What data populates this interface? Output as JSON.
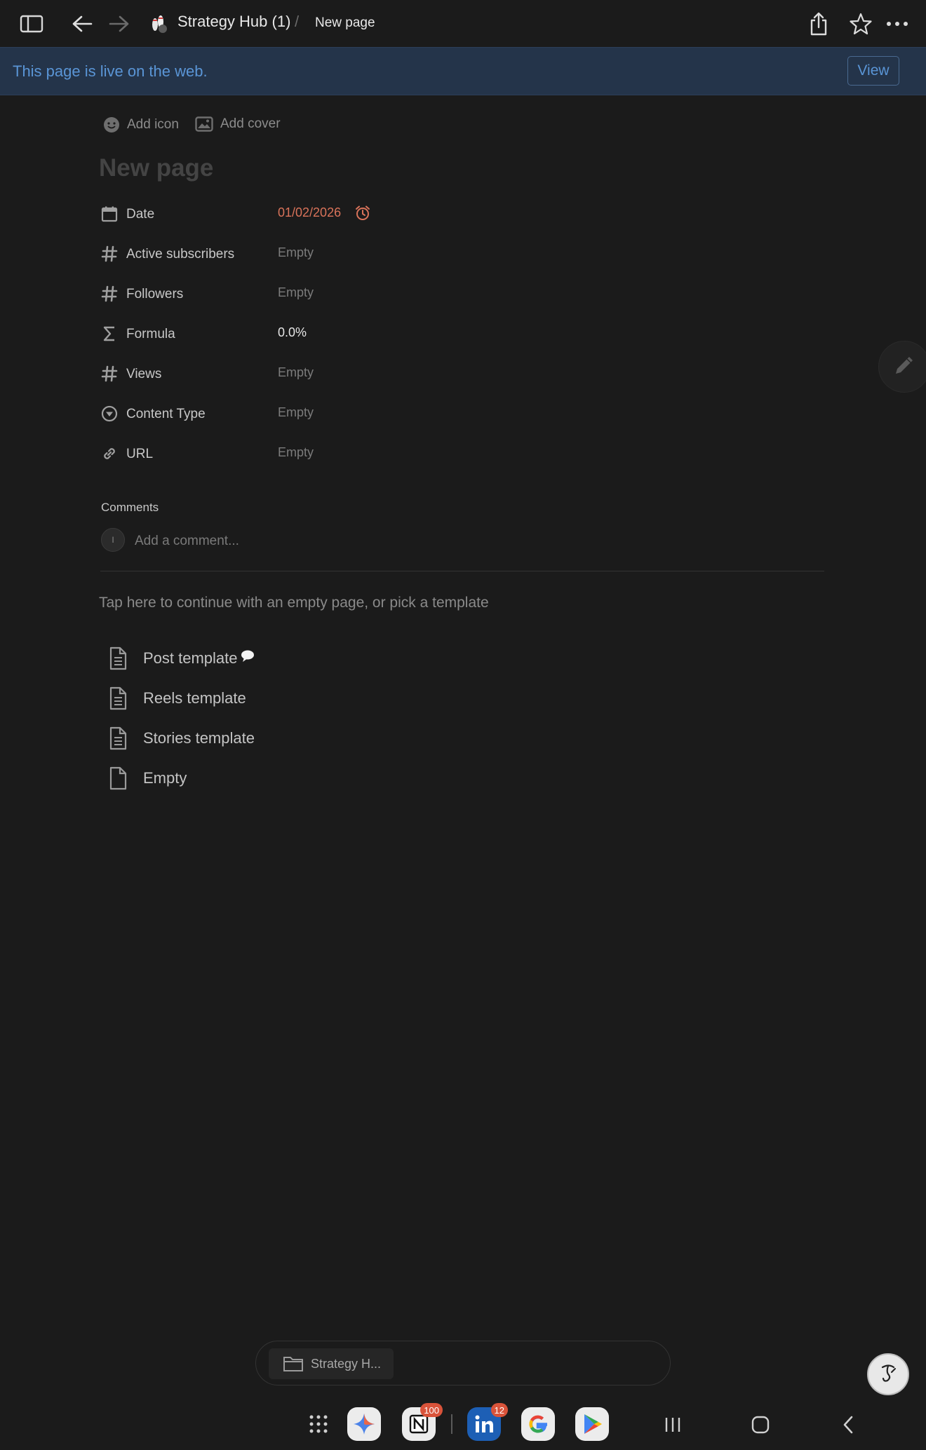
{
  "header": {
    "breadcrumb_workspace": "Strategy Hub (1)",
    "breadcrumb_separator": "/",
    "breadcrumb_page": "New page",
    "workspace_emoji_icon": "bowling-pins-icon"
  },
  "banner": {
    "text": "This page is live on the web.",
    "view_label": "View"
  },
  "page": {
    "add_icon_label": "Add icon",
    "add_cover_label": "Add cover",
    "title_placeholder": "New page"
  },
  "properties": [
    {
      "icon": "calendar-icon",
      "label": "Date",
      "value": "01/02/2026"
    },
    {
      "icon": "hash-icon",
      "label": "Active subscribers",
      "value": "Empty"
    },
    {
      "icon": "hash-icon",
      "label": "Followers",
      "value": "Empty"
    },
    {
      "icon": "sigma-icon",
      "label": "Formula",
      "value": "0.0%"
    },
    {
      "icon": "hash-icon",
      "label": "Views",
      "value": "Empty"
    },
    {
      "icon": "select-icon",
      "label": "Content Type",
      "value": "Empty"
    },
    {
      "icon": "link-icon",
      "label": "URL",
      "value": "Empty"
    }
  ],
  "comments": {
    "heading": "Comments",
    "avatar_initial": "I",
    "placeholder": "Add a comment..."
  },
  "templates": {
    "hint": "Tap here to continue with an empty page, or pick a template",
    "items": [
      {
        "label": "Post template",
        "icon": "document-lines-icon"
      },
      {
        "label": "Reels template",
        "icon": "document-lines-icon"
      },
      {
        "label": "Stories template",
        "icon": "document-lines-icon"
      },
      {
        "label": "Empty",
        "icon": "document-blank-icon"
      }
    ]
  },
  "taskbar": {
    "chip_label": "Strategy H..."
  },
  "dock": {
    "notion_badge": "100",
    "linkedin_badge": "12"
  },
  "colors": {
    "background": "#1b1b1b",
    "banner": "#24344a",
    "link_blue": "#5a95d6",
    "date_accent": "#d9735a"
  }
}
